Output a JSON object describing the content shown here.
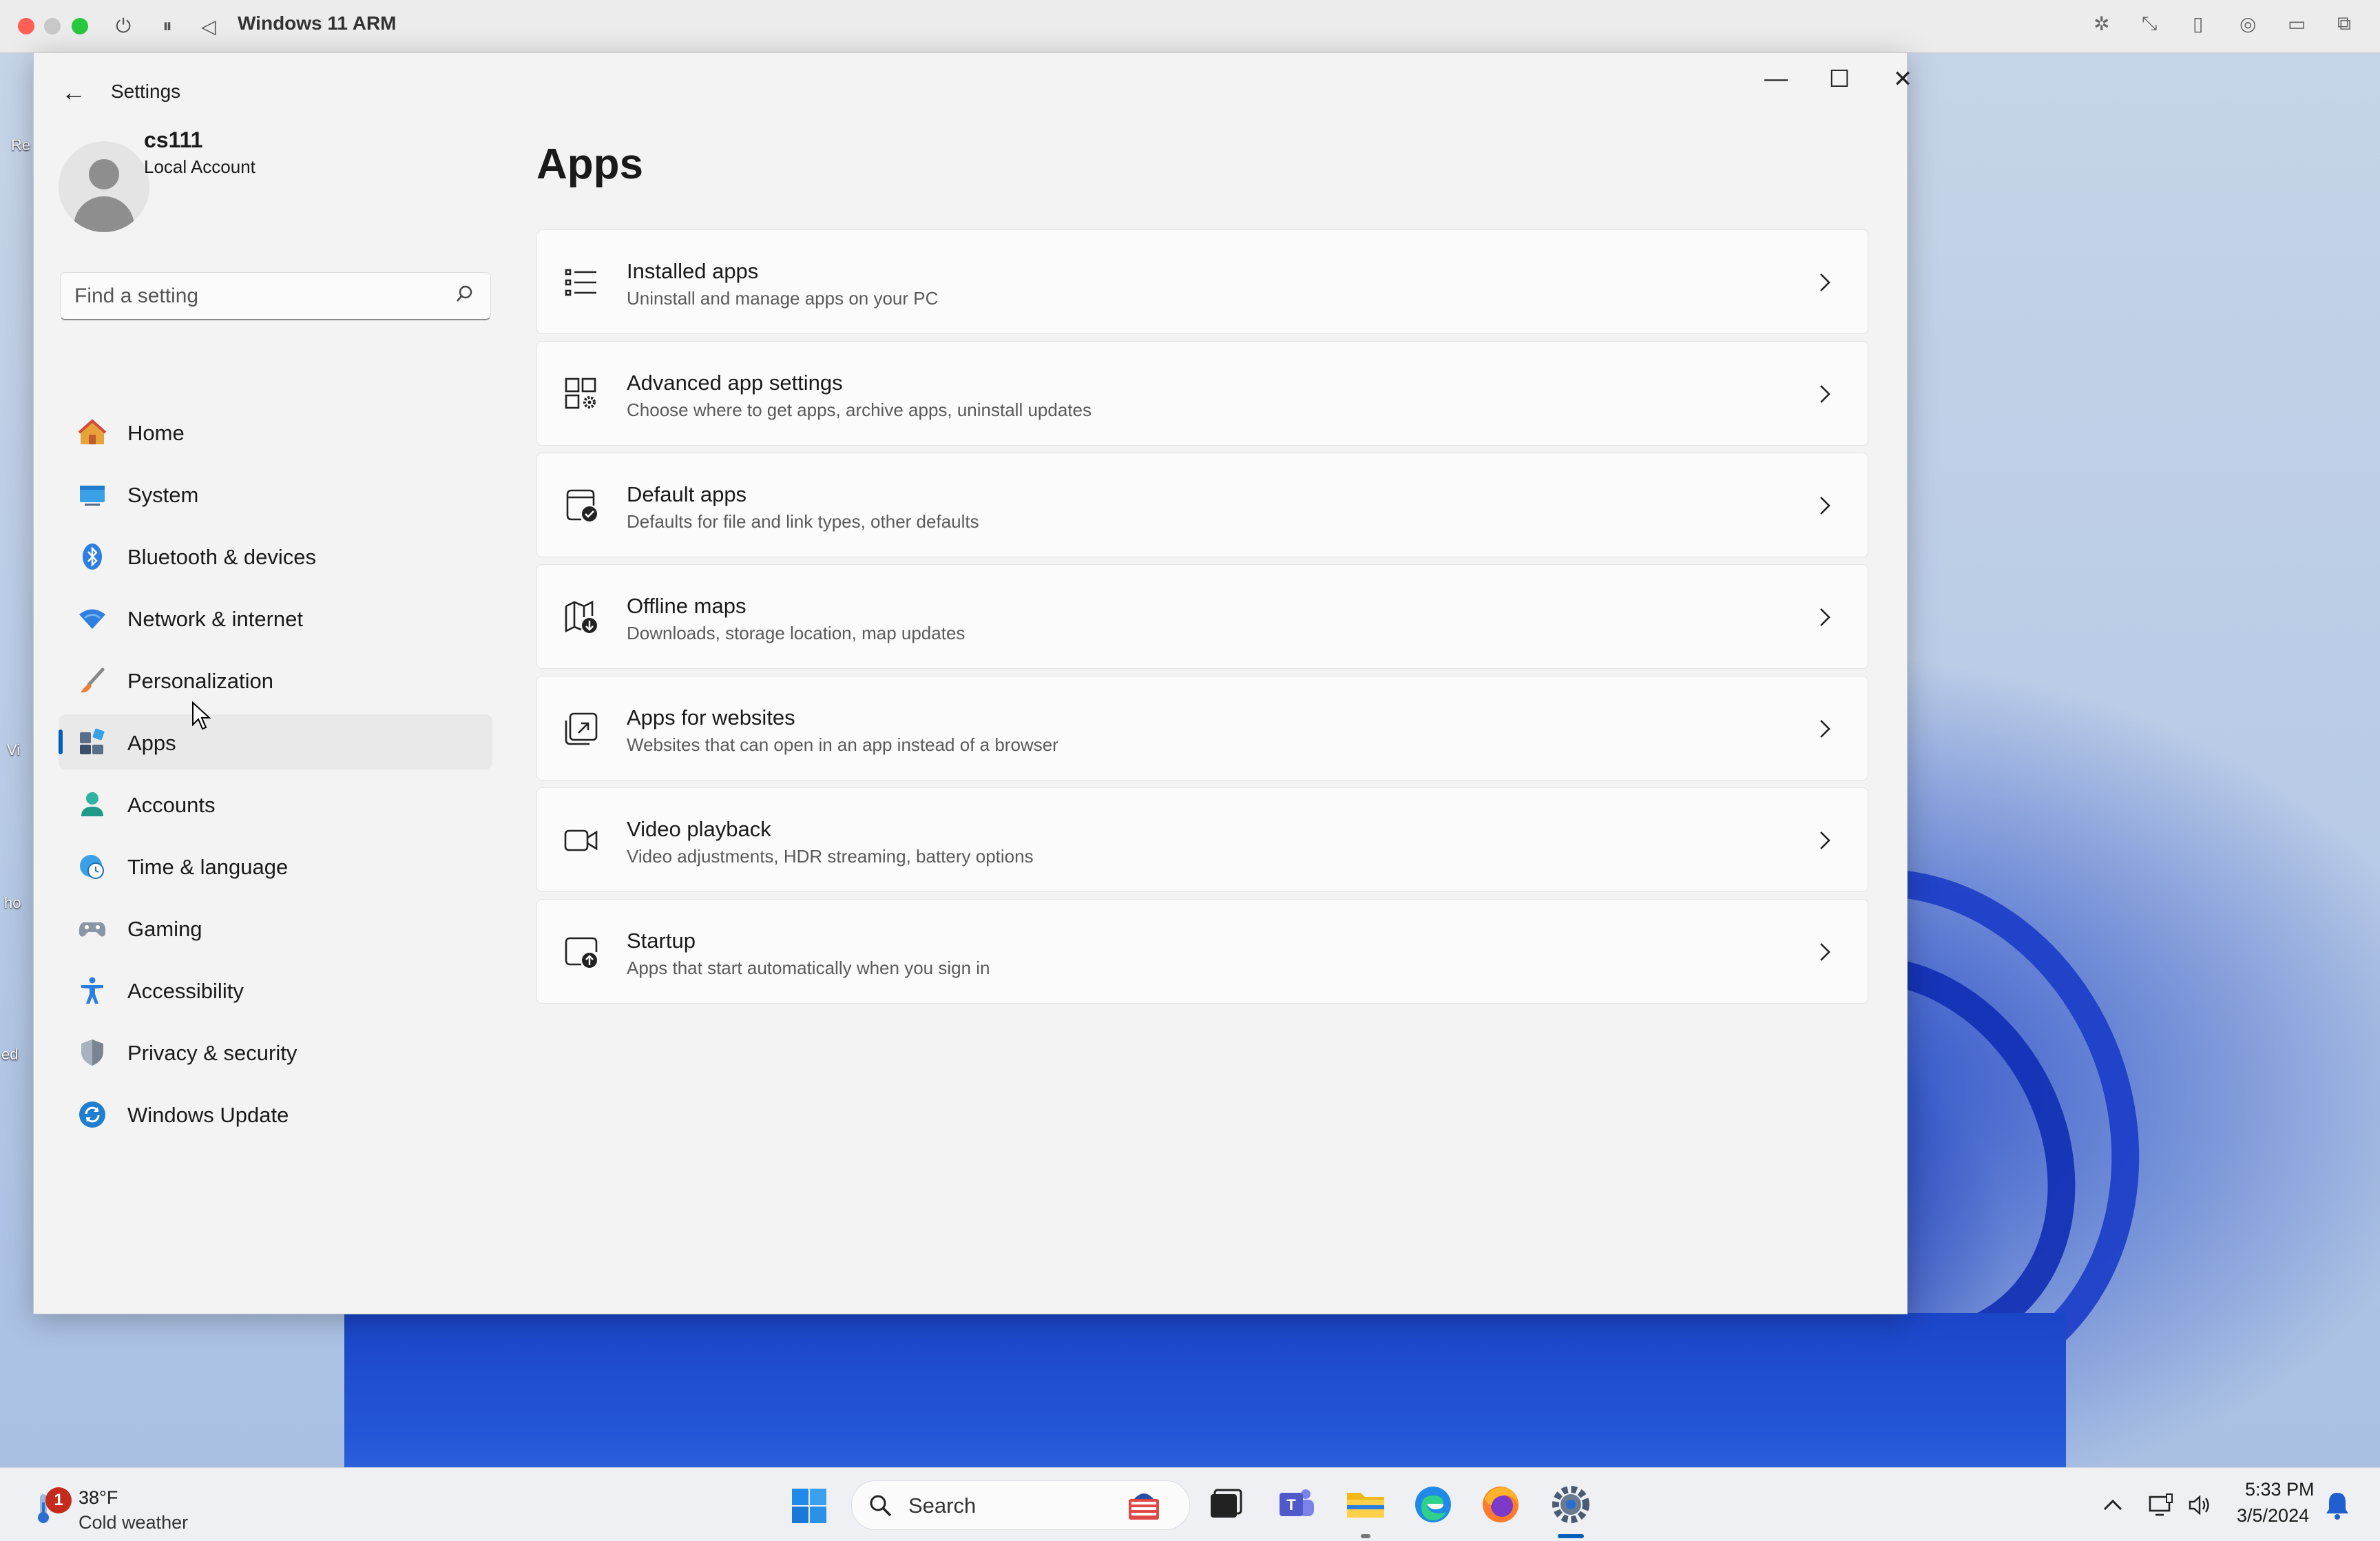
{
  "vm": {
    "title": "Windows 11 ARM"
  },
  "window": {
    "title": "Settings"
  },
  "profile": {
    "name": "cs111",
    "account_type": "Local Account"
  },
  "search": {
    "placeholder": "Find a setting"
  },
  "nav": {
    "items": [
      {
        "label": "Home",
        "icon": "home-icon"
      },
      {
        "label": "System",
        "icon": "monitor-icon"
      },
      {
        "label": "Bluetooth & devices",
        "icon": "bluetooth-icon"
      },
      {
        "label": "Network & internet",
        "icon": "wifi-icon"
      },
      {
        "label": "Personalization",
        "icon": "brush-icon"
      },
      {
        "label": "Apps",
        "icon": "apps-icon",
        "selected": true
      },
      {
        "label": "Accounts",
        "icon": "person-icon"
      },
      {
        "label": "Time & language",
        "icon": "globe-clock-icon"
      },
      {
        "label": "Gaming",
        "icon": "gamepad-icon"
      },
      {
        "label": "Accessibility",
        "icon": "accessibility-icon"
      },
      {
        "label": "Privacy & security",
        "icon": "shield-icon"
      },
      {
        "label": "Windows Update",
        "icon": "sync-icon"
      }
    ]
  },
  "main": {
    "title": "Apps",
    "cards": [
      {
        "title": "Installed apps",
        "subtitle": "Uninstall and manage apps on your PC",
        "icon": "list-icon"
      },
      {
        "title": "Advanced app settings",
        "subtitle": "Choose where to get apps, archive apps, uninstall updates",
        "icon": "app-gear-icon"
      },
      {
        "title": "Default apps",
        "subtitle": "Defaults for file and link types, other defaults",
        "icon": "app-check-icon"
      },
      {
        "title": "Offline maps",
        "subtitle": "Downloads, storage location, map updates",
        "icon": "map-download-icon"
      },
      {
        "title": "Apps for websites",
        "subtitle": "Websites that can open in an app instead of a browser",
        "icon": "open-external-icon"
      },
      {
        "title": "Video playback",
        "subtitle": "Video adjustments, HDR streaming, battery options",
        "icon": "video-camera-icon"
      },
      {
        "title": "Startup",
        "subtitle": "Apps that start automatically when you sign in",
        "icon": "startup-icon"
      }
    ]
  },
  "taskbar": {
    "weather_badge": "1",
    "weather_temp": "38°F",
    "weather_desc": "Cold weather",
    "search_label": "Search",
    "time": "5:33 PM",
    "date": "3/5/2024"
  },
  "colors": {
    "accent": "#005fb8",
    "window_bg": "#f3f3f3",
    "card_bg": "#fbfbfb"
  }
}
